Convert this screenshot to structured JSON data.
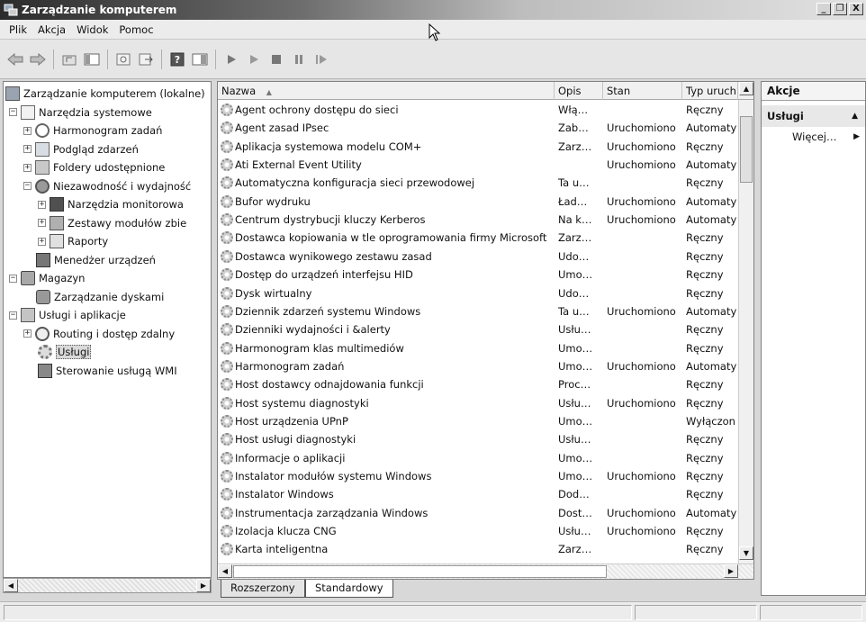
{
  "window": {
    "title": "Zarządzanie komputerem"
  },
  "winbtns": {
    "minimize": "_",
    "maximize": "❐",
    "close": "X"
  },
  "menubar": [
    "Plik",
    "Akcja",
    "Widok",
    "Pomoc"
  ],
  "tree": [
    {
      "label": "Zarządzanie komputerem (lokalne)",
      "icon": "computer-icon",
      "expander": "",
      "level": 0
    },
    {
      "label": "Narzędzia systemowe",
      "icon": "tools-icon",
      "expander": "−",
      "level": 1
    },
    {
      "label": "Harmonogram zadań",
      "icon": "clock-icon",
      "expander": "+",
      "level": 2
    },
    {
      "label": "Podgląd zdarzeń",
      "icon": "event-viewer-icon",
      "expander": "+",
      "level": 2
    },
    {
      "label": "Foldery udostępnione",
      "icon": "shared-folders-icon",
      "expander": "+",
      "level": 2
    },
    {
      "label": "Niezawodność i wydajność",
      "icon": "performance-icon",
      "expander": "−",
      "level": 2
    },
    {
      "label": "Narzędzia monitorowa",
      "icon": "monitor-icon",
      "expander": "+",
      "level": 3
    },
    {
      "label": "Zestawy modułów zbie",
      "icon": "collector-sets-icon",
      "expander": "+",
      "level": 3
    },
    {
      "label": "Raporty",
      "icon": "reports-icon",
      "expander": "+",
      "level": 3
    },
    {
      "label": "Menedżer urządzeń",
      "icon": "device-manager-icon",
      "expander": "",
      "level": 2
    },
    {
      "label": "Magazyn",
      "icon": "storage-icon",
      "expander": "−",
      "level": 0
    },
    {
      "label": "Zarządzanie dyskami",
      "icon": "disk-icon",
      "expander": "",
      "level": 2
    },
    {
      "label": "Usługi i aplikacje",
      "icon": "services-apps-icon",
      "expander": "−",
      "level": 0
    },
    {
      "label": "Routing i dostęp zdalny",
      "icon": "routing-icon",
      "expander": "+",
      "level": 1
    },
    {
      "label": "Usługi",
      "icon": "services-icon",
      "expander": "",
      "level": 2,
      "selected": true
    },
    {
      "label": "Sterowanie usługą WMI",
      "icon": "wmi-icon",
      "expander": "",
      "level": 2
    }
  ],
  "table": {
    "columns": [
      "Nazwa",
      "Opis",
      "Stan",
      "Typ uruch"
    ],
    "sort_indicator": "▲",
    "rows": [
      [
        "Agent ochrony dostępu do sieci",
        "Włą…",
        "",
        "Ręczny"
      ],
      [
        "Agent zasad IPsec",
        "Zab…",
        "Uruchomiono",
        "Automaty"
      ],
      [
        "Aplikacja systemowa modelu COM+",
        "Zarz…",
        "Uruchomiono",
        "Ręczny"
      ],
      [
        "Ati External Event Utility",
        "",
        "Uruchomiono",
        "Automaty"
      ],
      [
        "Automatyczna konfiguracja sieci przewodowej",
        "Ta u…",
        "",
        "Ręczny"
      ],
      [
        "Bufor wydruku",
        "Ład…",
        "Uruchomiono",
        "Automaty"
      ],
      [
        "Centrum dystrybucji kluczy Kerberos",
        "Na k…",
        "Uruchomiono",
        "Automaty"
      ],
      [
        "Dostawca kopiowania w tle oprogramowania firmy Microsoft",
        "Zarz…",
        "",
        "Ręczny"
      ],
      [
        "Dostawca wynikowego zestawu zasad",
        "Udo…",
        "",
        "Ręczny"
      ],
      [
        "Dostęp do urządzeń interfejsu HID",
        "Umo…",
        "",
        "Ręczny"
      ],
      [
        "Dysk wirtualny",
        "Udo…",
        "",
        "Ręczny"
      ],
      [
        "Dziennik zdarzeń systemu Windows",
        "Ta u…",
        "Uruchomiono",
        "Automaty"
      ],
      [
        "Dzienniki wydajności i &alerty",
        "Usłu…",
        "",
        "Ręczny"
      ],
      [
        "Harmonogram klas multimediów",
        "Umo…",
        "",
        "Ręczny"
      ],
      [
        "Harmonogram zadań",
        "Umo…",
        "Uruchomiono",
        "Automaty"
      ],
      [
        "Host dostawcy odnajdowania funkcji",
        "Proc…",
        "",
        "Ręczny"
      ],
      [
        "Host systemu diagnostyki",
        "Usłu…",
        "Uruchomiono",
        "Ręczny"
      ],
      [
        "Host urządzenia UPnP",
        "Umo…",
        "",
        "Wyłączon"
      ],
      [
        "Host usługi diagnostyki",
        "Usłu…",
        "",
        "Ręczny"
      ],
      [
        "Informacje o aplikacji",
        "Umo…",
        "",
        "Ręczny"
      ],
      [
        "Instalator modułów systemu Windows",
        "Umo…",
        "Uruchomiono",
        "Ręczny"
      ],
      [
        "Instalator Windows",
        "Dod…",
        "",
        "Ręczny"
      ],
      [
        "Instrumentacja zarządzania Windows",
        "Dost…",
        "Uruchomiono",
        "Automaty"
      ],
      [
        "Izolacja klucza CNG",
        "Usłu…",
        "Uruchomiono",
        "Ręczny"
      ],
      [
        "Karta inteligentna",
        "Zarz…",
        "",
        "Ręczny"
      ]
    ]
  },
  "tabs": [
    "Rozszerzony",
    "Standardowy"
  ],
  "actions": {
    "header": "Akcje",
    "section": "Usługi",
    "section_arrow": "▲",
    "item": "Więcej…",
    "item_arrow": "▶"
  },
  "scroll": {
    "up": "▲",
    "down": "▼",
    "left": "◀",
    "right": "▶"
  },
  "colors": {
    "titlebar_start": "#2c2c2c",
    "titlebar_end": "#e2e2e2"
  }
}
